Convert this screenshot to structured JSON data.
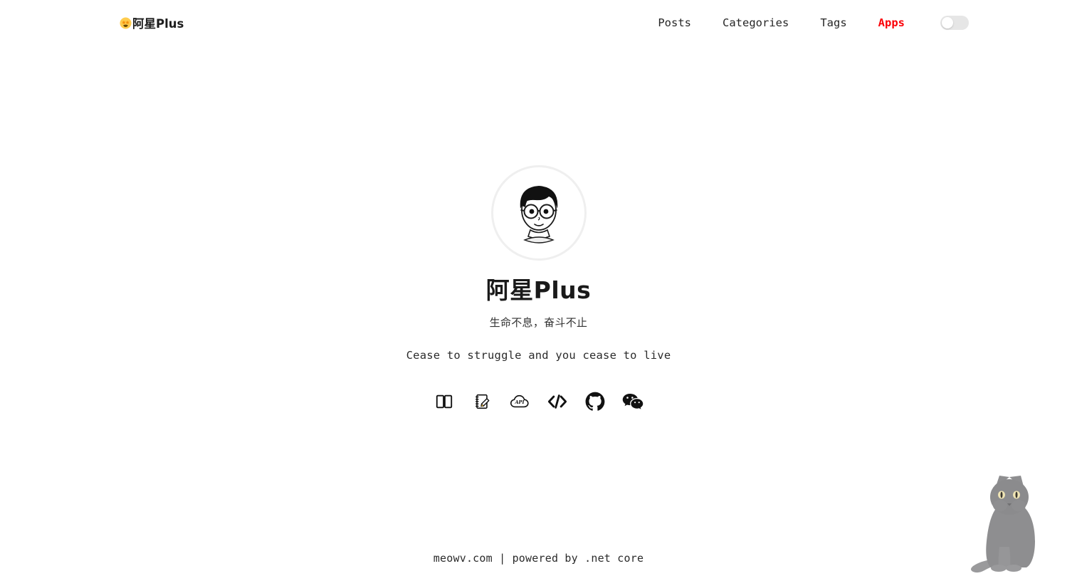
{
  "header": {
    "brand": {
      "emoji_name": "star-struck-emoji",
      "text": "阿星Plus"
    },
    "nav": [
      {
        "label": "Posts",
        "active": false
      },
      {
        "label": "Categories",
        "active": false
      },
      {
        "label": "Tags",
        "active": false
      },
      {
        "label": "Apps",
        "active": true
      }
    ],
    "theme_toggle": {
      "name": "theme-toggle",
      "state": "off"
    }
  },
  "hero": {
    "avatar_alt": "阿星Plus",
    "title": "阿星Plus",
    "tagline_cn": "生命不息，奋斗不止",
    "tagline_en": "Cease to struggle and you cease to live",
    "social": [
      {
        "name": "book-icon",
        "label": "book"
      },
      {
        "name": "notebook-pencil-icon",
        "label": "notes"
      },
      {
        "name": "api-cloud-icon",
        "label": "API"
      },
      {
        "name": "code-brackets-icon",
        "label": "code"
      },
      {
        "name": "github-icon",
        "label": "GitHub"
      },
      {
        "name": "wechat-icon",
        "label": "WeChat"
      }
    ]
  },
  "footer": {
    "text": "meowv.com | powered by .net core"
  },
  "mascot": {
    "name": "cat-mascot"
  },
  "colors": {
    "accent_red": "#fb0007",
    "text": "#2c2c2c",
    "background": "#ffffff",
    "avatar_ring": "#efefef",
    "toggle_track": "#e6e6e6",
    "cat_body": "#8e8e90",
    "cat_eye": "#efe4b4"
  }
}
